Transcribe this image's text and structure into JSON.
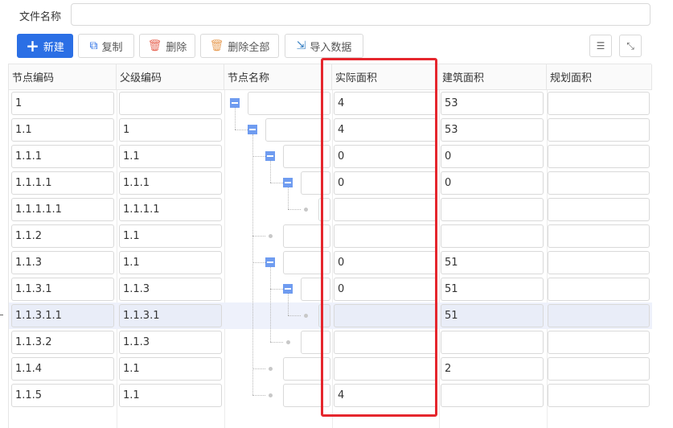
{
  "form": {
    "file_name_label": "文件名称",
    "file_name_value": ""
  },
  "toolbar": {
    "new_label": "新建",
    "copy_label": "复制",
    "delete_label": "删除",
    "delete_all_label": "删除全部",
    "import_label": "导入数据"
  },
  "table": {
    "headers": [
      "节点编码",
      "父级编码",
      "节点名称",
      "实际面积",
      "建筑面积",
      "规划面积"
    ],
    "rows": [
      {
        "code": "1",
        "parent": "",
        "name": "",
        "actual": "4",
        "building": "53",
        "planned": ""
      },
      {
        "code": "1.1",
        "parent": "1",
        "name": "",
        "actual": "4",
        "building": "53",
        "planned": ""
      },
      {
        "code": "1.1.1",
        "parent": "1.1",
        "name": "",
        "actual": "0",
        "building": "0",
        "planned": ""
      },
      {
        "code": "1.1.1.1",
        "parent": "1.1.1",
        "name": "",
        "actual": "0",
        "building": "0",
        "planned": ""
      },
      {
        "code": "1.1.1.1.1",
        "parent": "1.1.1.1",
        "name": "",
        "actual": "",
        "building": "",
        "planned": ""
      },
      {
        "code": "1.1.2",
        "parent": "1.1",
        "name": "",
        "actual": "",
        "building": "",
        "planned": ""
      },
      {
        "code": "1.1.3",
        "parent": "1.1",
        "name": "",
        "actual": "0",
        "building": "51",
        "planned": ""
      },
      {
        "code": "1.1.3.1",
        "parent": "1.1.3",
        "name": "",
        "actual": "0",
        "building": "51",
        "planned": ""
      },
      {
        "code": "1.1.3.1.1",
        "parent": "1.1.3.1",
        "name": "",
        "actual": "",
        "building": "51",
        "planned": ""
      },
      {
        "code": "1.1.3.2",
        "parent": "1.1.3",
        "name": "",
        "actual": "",
        "building": "",
        "planned": ""
      },
      {
        "code": "1.1.4",
        "parent": "1.1",
        "name": "",
        "actual": "",
        "building": "2",
        "planned": ""
      },
      {
        "code": "1.1.5",
        "parent": "1.1",
        "name": "",
        "actual": "4",
        "building": "",
        "planned": ""
      }
    ]
  },
  "colors": {
    "primary": "#2b6fe5",
    "highlight_border": "#e5262d",
    "tree_toggle": "#6f9cf0",
    "selected_row": "#eef1fb"
  },
  "icons": {
    "new": "plus-icon",
    "copy": "copy-icon",
    "delete": "trash-icon",
    "delete_all": "trash-all-icon",
    "import": "import-icon",
    "collapse_top": "collapse-top-icon",
    "fullscreen": "fullscreen-icon"
  }
}
